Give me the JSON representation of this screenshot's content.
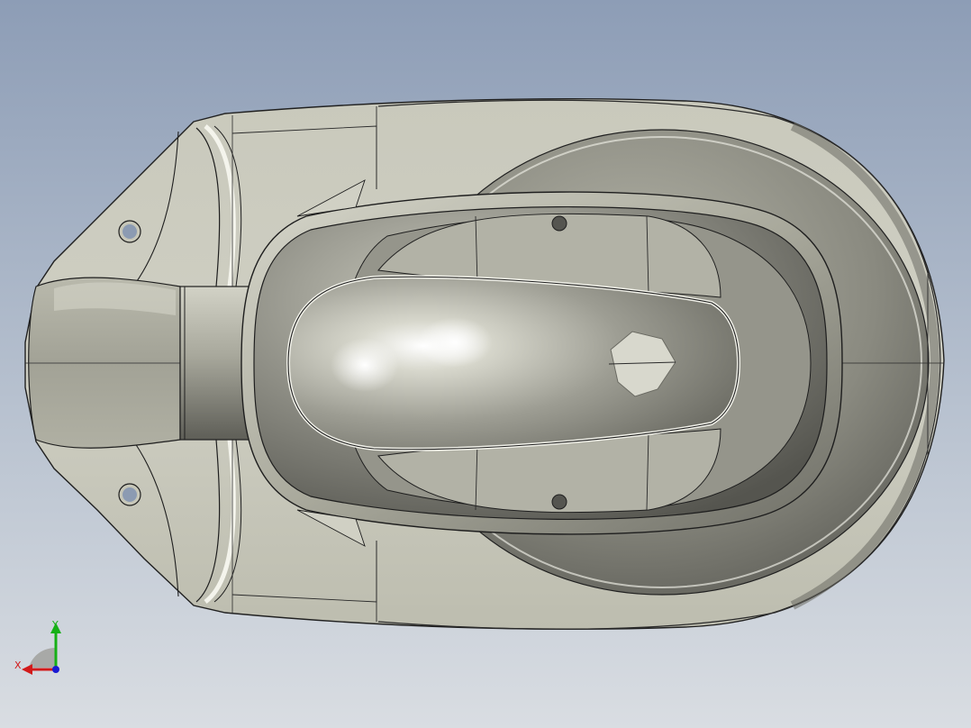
{
  "viewport": {
    "background_top": "#8d9db6",
    "background_bottom": "#d9dde2",
    "model": "squat-toilet-pan",
    "model_color": "#c3c3b5"
  },
  "triad": {
    "x_label": "X",
    "y_label": "Y",
    "x_color": "#d21a1a",
    "y_color": "#16b016",
    "z_color": "#1a1ad2"
  }
}
